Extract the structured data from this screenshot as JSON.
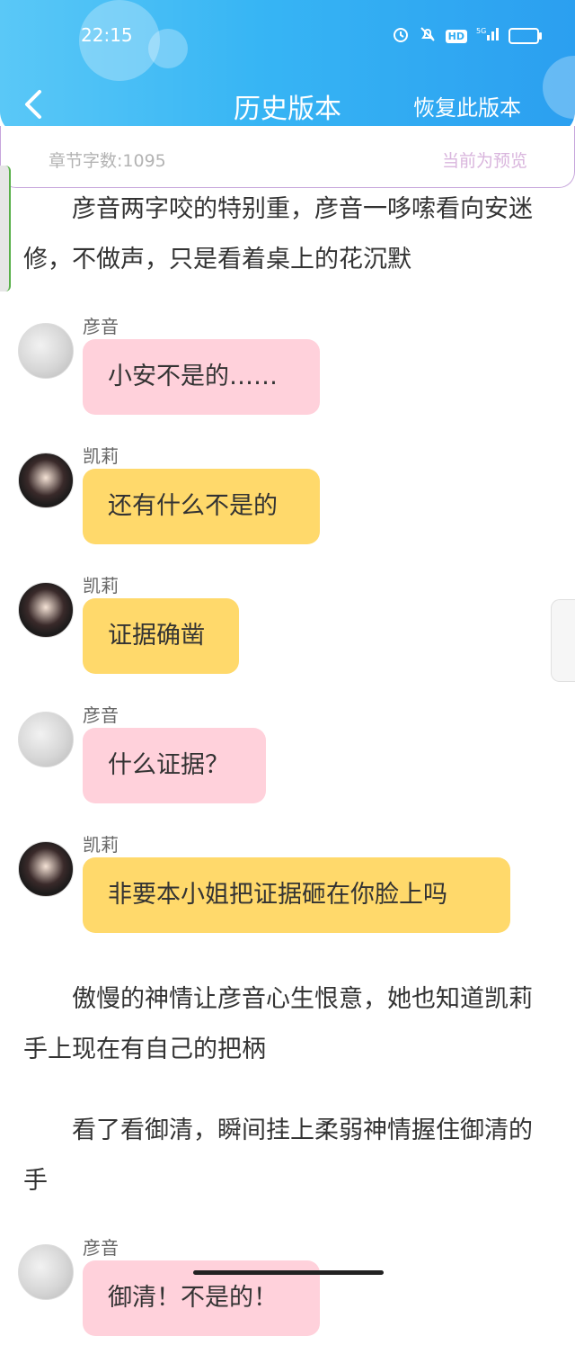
{
  "status_bar": {
    "time": "22:15",
    "hd": "HD",
    "network": "5G"
  },
  "header": {
    "title": "历史版本",
    "restore_label": "恢复此版本"
  },
  "subheader": {
    "word_count": "章节字数:1095",
    "preview_note": "当前为预览"
  },
  "content": {
    "para1": "彦音两字咬的特别重，彦音一哆嗦看向安迷修，不做声，只是看着桌上的花沉默",
    "messages": [
      {
        "sender": "彦音",
        "text": "小安不是的……"
      },
      {
        "sender": "凯莉",
        "text": "还有什么不是的"
      },
      {
        "sender": "凯莉",
        "text": "证据确凿"
      },
      {
        "sender": "彦音",
        "text": "什么证据？"
      },
      {
        "sender": "凯莉",
        "text": "非要本小姐把证据砸在你脸上吗"
      }
    ],
    "para2": "傲慢的神情让彦音心生恨意，她也知道凯莉手上现在有自己的把柄",
    "para3": "看了看御清，瞬间挂上柔弱神情握住御清的手",
    "last_message": {
      "sender": "彦音",
      "text": "御清！不是的！"
    }
  },
  "colors": {
    "header_gradient_start": "#5ac8f7",
    "header_gradient_end": "#2b9ff0",
    "pink_bubble": "#ffd1db",
    "yellow_bubble": "#ffd96b"
  }
}
